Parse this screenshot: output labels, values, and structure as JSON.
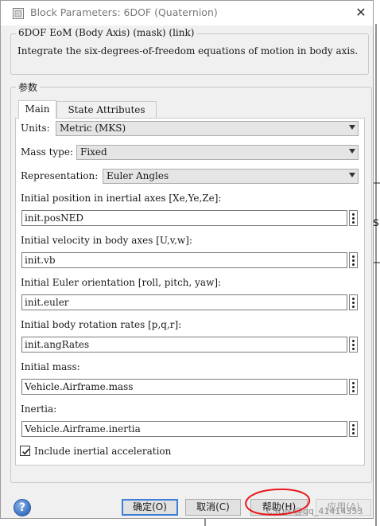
{
  "window": {
    "title": "Block Parameters: 6DOF (Quaternion)",
    "close_glyph": "✕"
  },
  "mask": {
    "legend": "6DOF EoM (Body Axis) (mask) (link)",
    "description": "Integrate the six-degrees-of-freedom equations of motion in body axis."
  },
  "params": {
    "legend": "参数",
    "tabs": [
      {
        "label": "Main",
        "selected": true
      },
      {
        "label": "State Attributes",
        "selected": false
      }
    ],
    "units": {
      "label": "Units:",
      "value": "Metric (MKS)"
    },
    "mass_type": {
      "label": "Mass type:",
      "value": "Fixed"
    },
    "representation": {
      "label": "Representation:",
      "value": "Euler Angles"
    },
    "fields": [
      {
        "label": "Initial position in inertial axes [Xe,Ye,Ze]:",
        "value": "init.posNED"
      },
      {
        "label": "Initial velocity in body axes [U,v,w]:",
        "value": "init.vb"
      },
      {
        "label": "Initial Euler orientation [roll, pitch, yaw]:",
        "value": "init.euler"
      },
      {
        "label": "Initial body rotation rates [p,q,r]:",
        "value": "init.angRates"
      },
      {
        "label": "Initial mass:",
        "value": "Vehicle.Airframe.mass"
      },
      {
        "label": "Inertia:",
        "value": "Vehicle.Airframe.inertia"
      }
    ],
    "include_inertial": {
      "label": "Include inertial acceleration",
      "checked": true
    }
  },
  "buttons": {
    "help_icon": "?",
    "ok": "确定(O)",
    "cancel": "取消(C)",
    "help": "帮助(H)",
    "apply": "应用(A)"
  },
  "background": {
    "side_letter": "s",
    "watermark": "CSDN @qq_41414353"
  },
  "icons": {
    "title_icon": "block-parameters-icon",
    "help_icon": "help-question-icon",
    "dots": "more-options-icon",
    "check": "checkmark-icon"
  },
  "colors": {
    "dialog_bg": "#f0f0f0",
    "ok_border": "#3c7fd6",
    "annotation_red": "#e8161b"
  }
}
